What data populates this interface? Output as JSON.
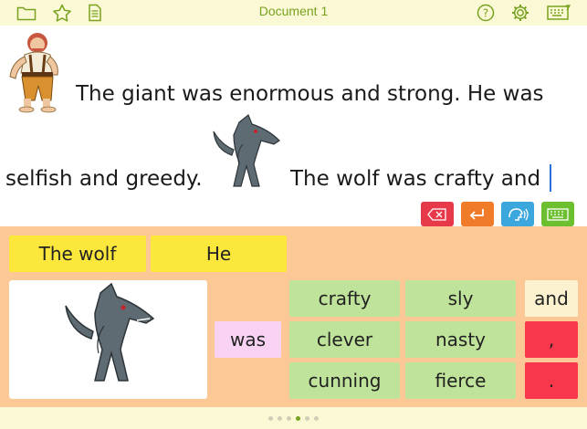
{
  "toolbar": {
    "title": "Document 1",
    "icons": [
      "folder-icon",
      "star-icon",
      "document-icon",
      "help-icon",
      "gear-icon",
      "keyboard-grid-icon"
    ],
    "accent_color": "#77a21f"
  },
  "document": {
    "line1": "The giant was enormous and strong. He was",
    "line2a": "selfish and greedy.",
    "line2b": "The wolf was crafty and"
  },
  "actions": {
    "delete": {
      "icon": "backspace-icon",
      "color": "#e8394b"
    },
    "enter": {
      "icon": "return-icon",
      "color": "#f07c2a"
    },
    "speak": {
      "icon": "speak-icon",
      "color": "#3ba7dd"
    },
    "keyboard": {
      "icon": "keyboard-icon",
      "color": "#6cbf2e"
    }
  },
  "grid": {
    "subjects": [
      "The wolf",
      "He"
    ],
    "verb": "was",
    "adjectives": [
      "crafty",
      "sly",
      "clever",
      "nasty",
      "cunning",
      "fierce"
    ],
    "punctuation": [
      "and",
      ",",
      "."
    ]
  },
  "pagination": {
    "pages": 6,
    "current": 4
  }
}
